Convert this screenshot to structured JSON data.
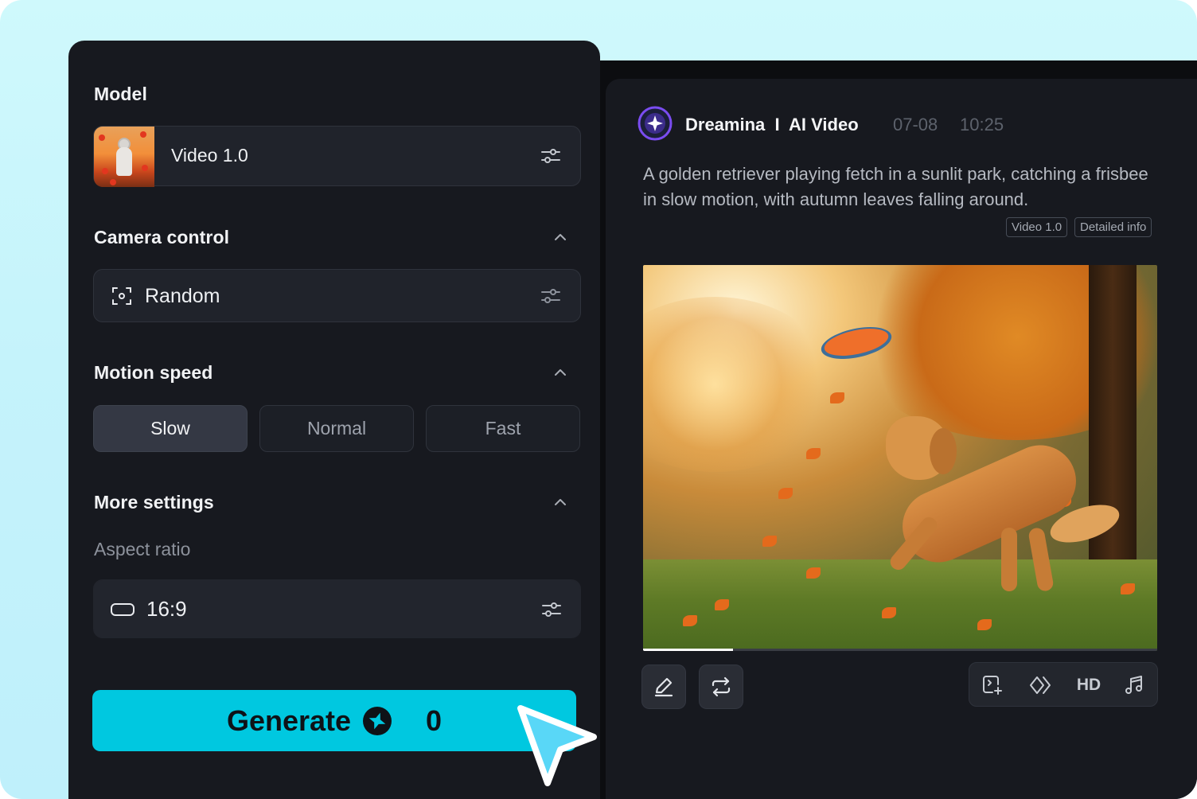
{
  "settings": {
    "model": {
      "section_title": "Model",
      "value": "Video 1.0"
    },
    "camera_control": {
      "section_title": "Camera control",
      "value": "Random"
    },
    "motion_speed": {
      "section_title": "Motion speed",
      "options": [
        "Slow",
        "Normal",
        "Fast"
      ],
      "selected": "Slow"
    },
    "more_settings": {
      "section_title": "More settings",
      "aspect_ratio_label": "Aspect ratio",
      "aspect_ratio_value": "16:9"
    },
    "generate": {
      "label": "Generate",
      "credits": "0"
    }
  },
  "result": {
    "app_title": "Dreamina  I  AI Video",
    "date": "07-08",
    "time": "10:25",
    "prompt": "A golden retriever playing fetch in a sunlit park, catching a frisbee in slow motion, with autumn leaves falling around.",
    "tags": [
      "Video 1.0",
      "Detailed info"
    ],
    "video_progress": 0.175,
    "toolbar": {
      "left_tools": [
        "edit-icon",
        "regenerate-icon"
      ],
      "right_tools": [
        "extend-icon",
        "interpolate-icon",
        "HD",
        "music-icon"
      ],
      "hd_label": "HD"
    }
  },
  "colors": {
    "accent": "#00c8e0",
    "panel": "#17191f",
    "background": "#c8f5fb"
  }
}
